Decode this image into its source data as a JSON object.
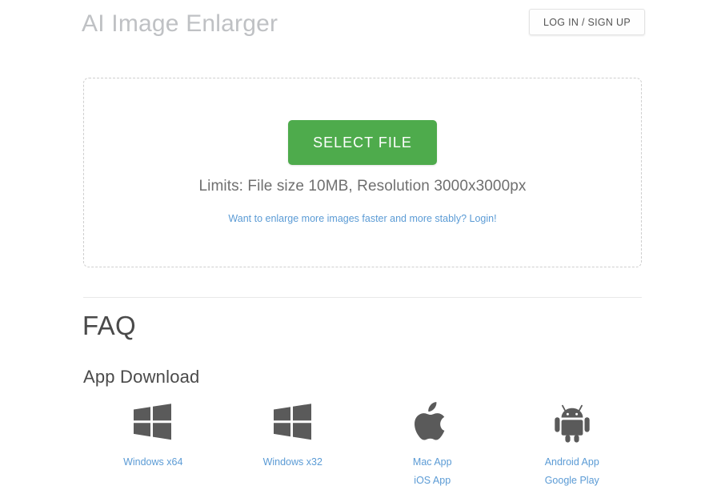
{
  "header": {
    "title": "AI Image Enlarger",
    "login_button_label": "LOG IN / SIGN UP"
  },
  "uploader": {
    "select_file_label": "SELECT FILE",
    "limits_text": "Limits: File size 10MB, Resolution 3000x3000px",
    "login_hint_label": "Want to enlarge more images faster and more stably? Login!"
  },
  "faq": {
    "heading": "FAQ",
    "app_download_heading": "App Download",
    "apps": [
      {
        "icon": "windows-icon",
        "links": [
          "Windows x64"
        ]
      },
      {
        "icon": "windows-icon",
        "links": [
          "Windows x32"
        ]
      },
      {
        "icon": "apple-icon",
        "links": [
          "Mac App",
          "iOS App"
        ]
      },
      {
        "icon": "android-icon",
        "links": [
          "Android App",
          "Google Play"
        ]
      }
    ]
  },
  "colors": {
    "accent_green": "#4eab4c",
    "link_blue": "#5b9bd5",
    "title_gray": "#bfc1c4",
    "icon_gray": "#5a5a5a"
  }
}
